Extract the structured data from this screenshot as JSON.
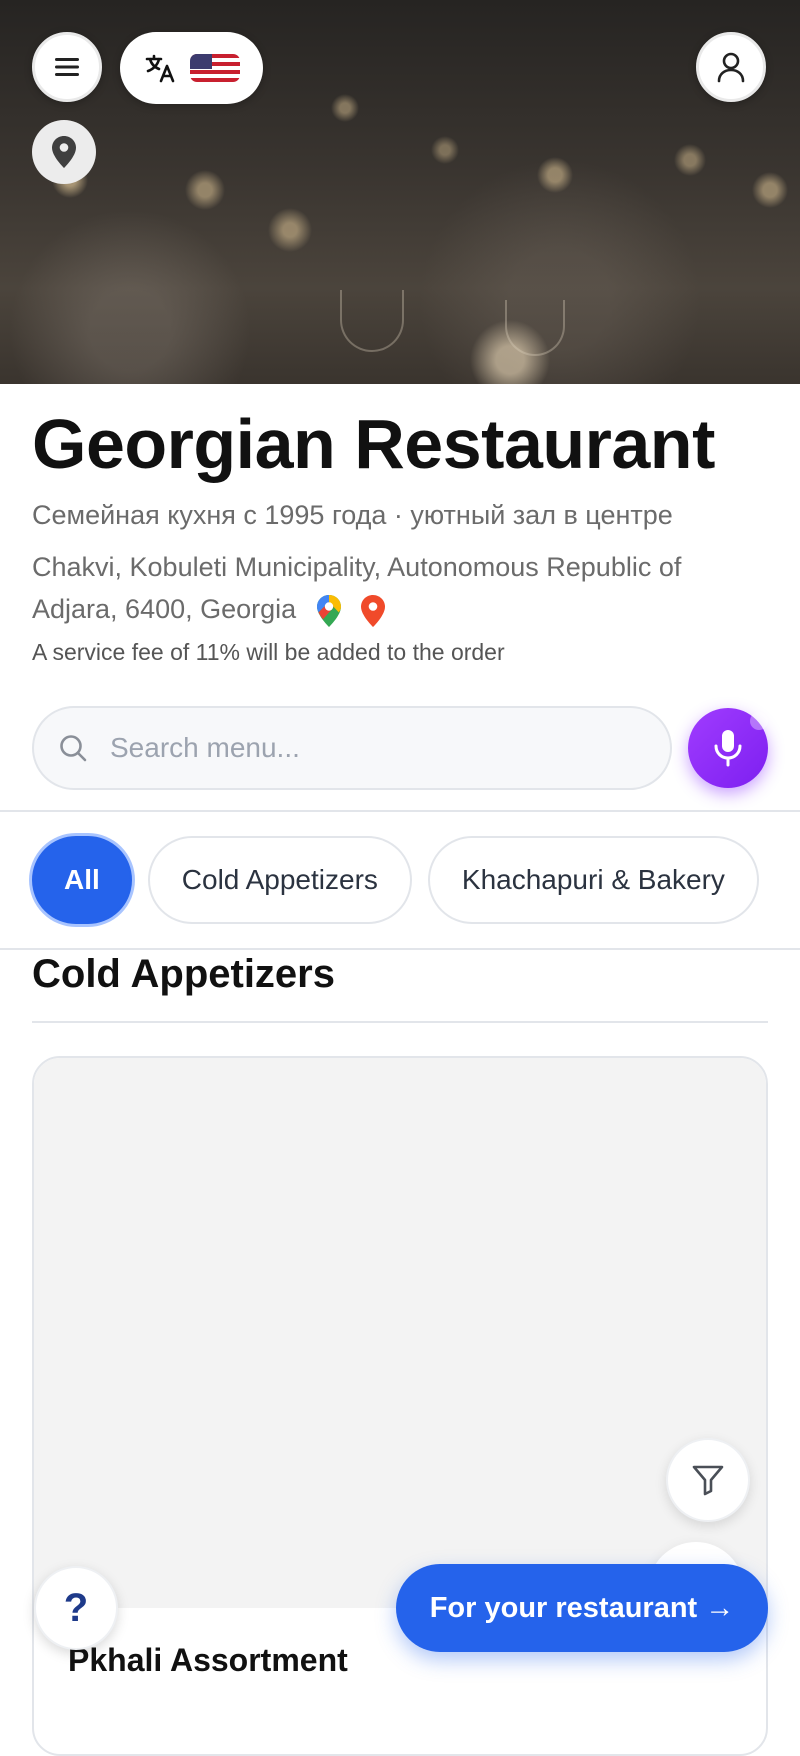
{
  "header": {
    "menu_icon": "hamburger-icon",
    "language_icon": "translate-icon",
    "language_flag": "us-flag",
    "profile_icon": "user-icon",
    "location_icon": "map-pin-icon"
  },
  "restaurant": {
    "name": "Georgian Restaurant",
    "tagline": "Семейная кухня с 1995 года · уютный зал в центре",
    "address": "Chakvi, Kobuleti Municipality, Autonomous Republic of Adjara, 6400, Georgia",
    "service_fee_note": "A service fee of 11% will be added to the order"
  },
  "search": {
    "placeholder": "Search menu...",
    "value": ""
  },
  "categories": [
    {
      "label": "All",
      "active": true
    },
    {
      "label": "Cold Appetizers",
      "active": false
    },
    {
      "label": "Khachapuri & Bakery",
      "active": false
    }
  ],
  "section": {
    "title": "Cold Appetizers"
  },
  "menu_items": [
    {
      "name": "Pkhali Assortment"
    }
  ],
  "floating": {
    "help_label": "?",
    "cta_label": "For your restaurant →"
  },
  "colors": {
    "accent_blue": "#2563eb",
    "mic_purple": "#8b2cf5",
    "muted_text": "#6b6b6b"
  }
}
